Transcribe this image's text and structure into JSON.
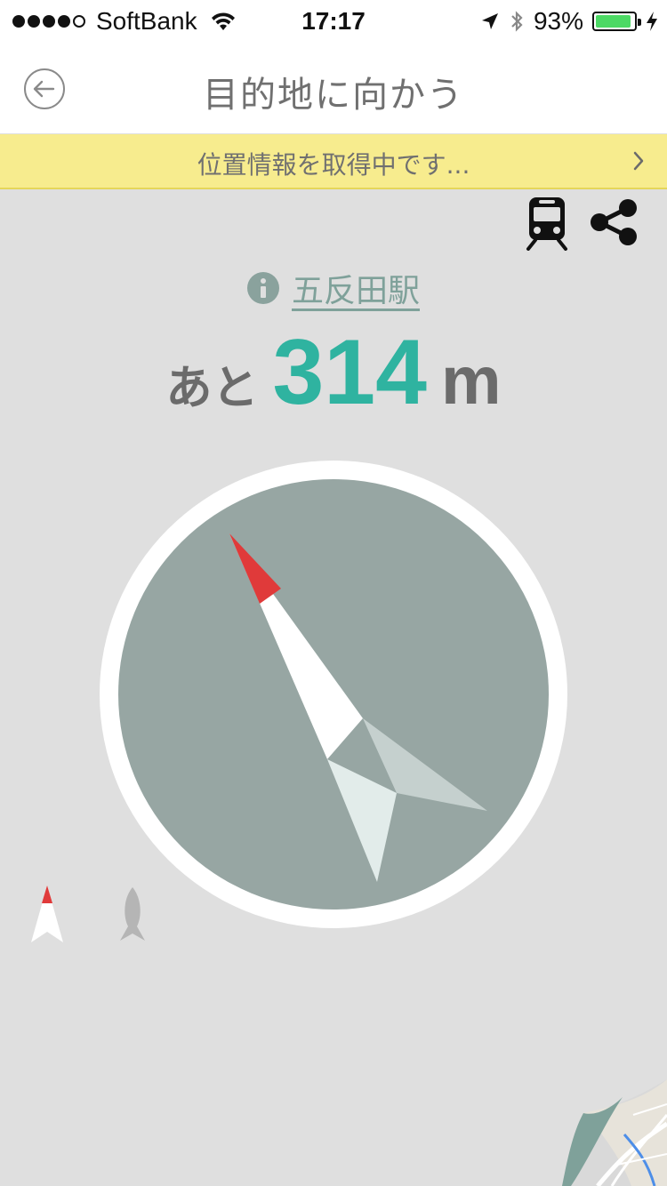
{
  "status_bar": {
    "carrier": "SoftBank",
    "time": "17:17",
    "battery_percent": "93%",
    "battery_level": 0.93,
    "signal_bars": 4,
    "battery_color": "#4cd964"
  },
  "header": {
    "title": "目的地に向かう",
    "back_icon": "back-arrow-circle-icon"
  },
  "banner": {
    "text": "位置情報を取得中です...",
    "background": "#f7ec8e"
  },
  "toolbar": {
    "train_icon": "train-icon",
    "share_icon": "share-icon"
  },
  "destination": {
    "name": "五反田駅"
  },
  "distance": {
    "prefix": "あと",
    "value": "314",
    "unit": "m",
    "accent": "#2fb3a0"
  },
  "compass": {
    "dial_color": "#97a6a3",
    "needle_tip_color": "#e03a3a"
  },
  "colors": {
    "background": "#dfdfdf",
    "text_gray": "#6b6b6b"
  }
}
